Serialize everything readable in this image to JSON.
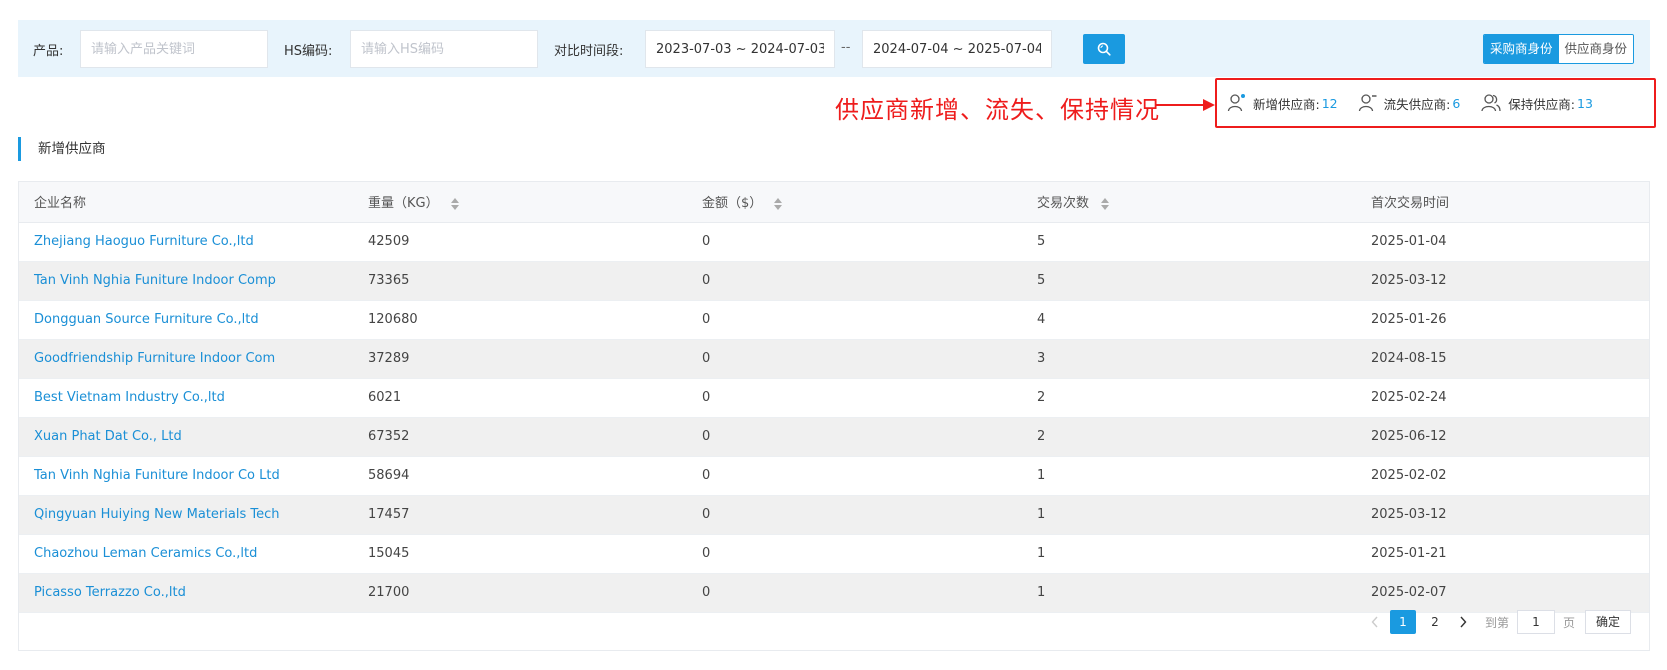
{
  "filters": {
    "product_label": "产品:",
    "product_placeholder": "请输入产品关键词",
    "hs_label": "HS编码:",
    "hs_placeholder": "请输入HS编码",
    "period_label": "对比时间段:",
    "period_a": "2023-07-03 ~ 2024-07-03",
    "period_separator": "--",
    "period_b": "2024-07-04 ~ 2025-07-04",
    "search_icon": "search-icon"
  },
  "identity": {
    "buyer": "采购商身份",
    "supplier": "供应商身份",
    "active": "buyer"
  },
  "annotation": {
    "text": "供应商新增、流失、保持情况",
    "color": "#ee1c1c"
  },
  "stats": {
    "new_label": "新增供应商:",
    "new_count": "12",
    "lost_label": "流失供应商:",
    "lost_count": "6",
    "kept_label": "保持供应商:",
    "kept_count": "13"
  },
  "section": {
    "title": "新增供应商"
  },
  "table": {
    "columns": [
      "企业名称",
      "重量（KG）",
      "金额（$）",
      "交易次数",
      "首次交易时间"
    ],
    "rows": [
      [
        "Zhejiang Haoguo Furniture Co.,ltd",
        "42509",
        "0",
        "5",
        "2025-01-04"
      ],
      [
        "Tan Vinh Nghia Funiture Indoor Comp",
        "73365",
        "0",
        "5",
        "2025-03-12"
      ],
      [
        "Dongguan Source Furniture Co.,ltd",
        "120680",
        "0",
        "4",
        "2025-01-26"
      ],
      [
        "Goodfriendship Furniture Indoor Com",
        "37289",
        "0",
        "3",
        "2024-08-15"
      ],
      [
        "Best Vietnam Industry Co.,ltd",
        "6021",
        "0",
        "2",
        "2025-02-24"
      ],
      [
        "Xuan Phat Dat Co., Ltd",
        "67352",
        "0",
        "2",
        "2025-06-12"
      ],
      [
        "Tan Vinh Nghia Funiture Indoor Co Ltd",
        "58694",
        "0",
        "1",
        "2025-02-02"
      ],
      [
        "Qingyuan Huiying New Materials Tech",
        "17457",
        "0",
        "1",
        "2025-03-12"
      ],
      [
        "Chaozhou Leman Ceramics Co.,ltd",
        "15045",
        "0",
        "1",
        "2025-01-21"
      ],
      [
        "Picasso Terrazzo Co.,ltd",
        "21700",
        "0",
        "1",
        "2025-02-07"
      ]
    ]
  },
  "pagination": {
    "pages": [
      "1",
      "2"
    ],
    "current": "1",
    "goto_label": "到第",
    "goto_value": "1",
    "page_suffix": "页",
    "confirm": "确定"
  },
  "colors": {
    "accent": "#1a9ae0",
    "link": "#1a8fd6",
    "annotation": "#ee1c1c",
    "filter_bg": "#e8f4fc"
  }
}
